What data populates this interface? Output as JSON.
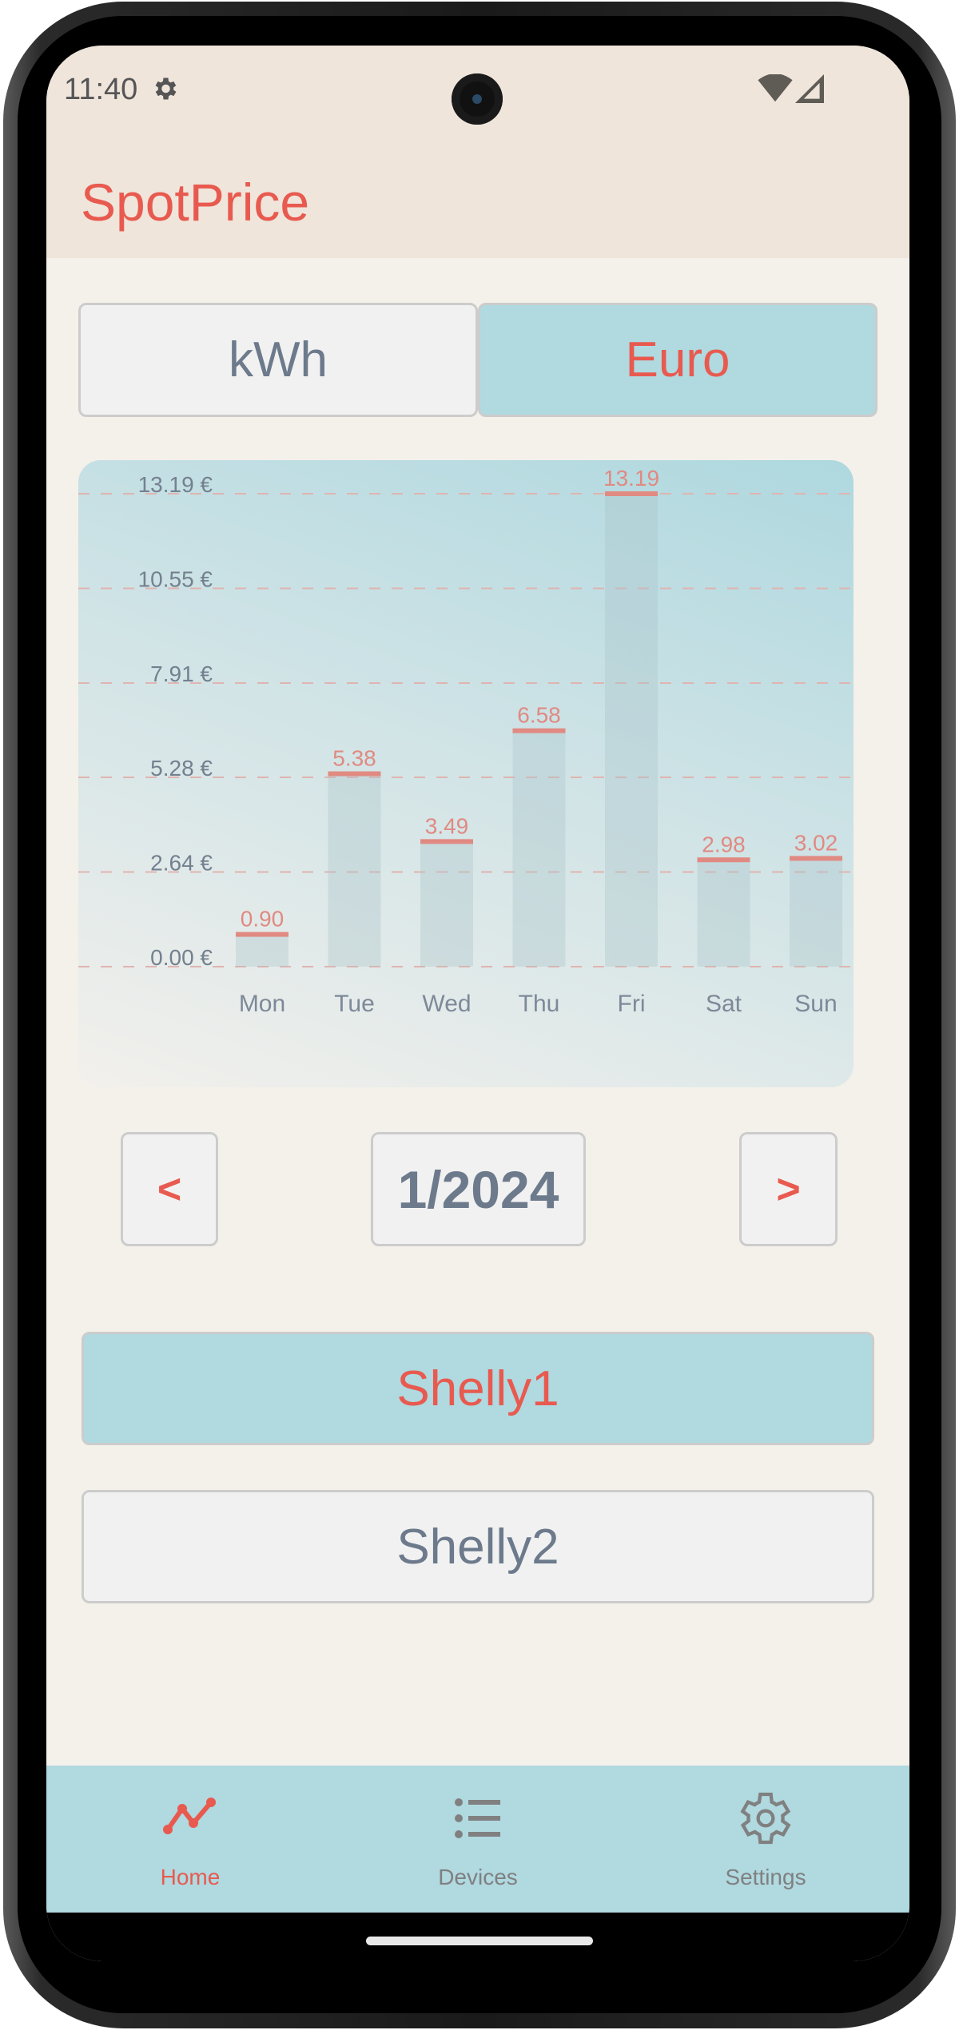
{
  "status_bar": {
    "time": "11:40",
    "icons": [
      "gear-icon",
      "wifi-icon",
      "signal-icon"
    ]
  },
  "app_bar": {
    "title": "SpotPrice"
  },
  "unit_toggle": {
    "options": [
      {
        "label": "kWh",
        "selected": false
      },
      {
        "label": "Euro",
        "selected": true
      }
    ]
  },
  "pager": {
    "prev_label": "<",
    "period_label": "1/2024",
    "next_label": ">"
  },
  "devices": [
    {
      "label": "Shelly1",
      "selected": true
    },
    {
      "label": "Shelly2",
      "selected": false
    }
  ],
  "bottom_nav": {
    "items": [
      {
        "label": "Home",
        "icon": "chart-line-icon",
        "active": true
      },
      {
        "label": "Devices",
        "icon": "list-icon",
        "active": false
      },
      {
        "label": "Settings",
        "icon": "gear-icon",
        "active": false
      }
    ]
  },
  "colors": {
    "accent": "#e85a4f",
    "selected_bg": "#b0d9e0",
    "unselected_bg": "#f1f1f1",
    "text_muted": "#6c7a8c",
    "app_bar_bg": "#efe5db",
    "content_bg": "#f4f1ea"
  },
  "chart_data": {
    "type": "bar",
    "title": "",
    "xlabel": "",
    "ylabel": "",
    "categories": [
      "Mon",
      "Tue",
      "Wed",
      "Thu",
      "Fri",
      "Sat",
      "Sun"
    ],
    "values": [
      0.9,
      5.38,
      3.49,
      6.58,
      13.19,
      2.98,
      3.02
    ],
    "value_labels": [
      "0.90",
      "5.38",
      "3.49",
      "6.58",
      "13.19",
      "2.98",
      "3.02"
    ],
    "y_ticks": [
      0.0,
      2.64,
      5.28,
      7.91,
      10.55,
      13.19
    ],
    "y_tick_labels": [
      "0.00 €",
      "2.64 €",
      "5.28 €",
      "7.91 €",
      "10.55 €",
      "13.19 €"
    ],
    "ylim": [
      0,
      13.19
    ],
    "grid": true,
    "legend": "none",
    "unit": "€"
  }
}
